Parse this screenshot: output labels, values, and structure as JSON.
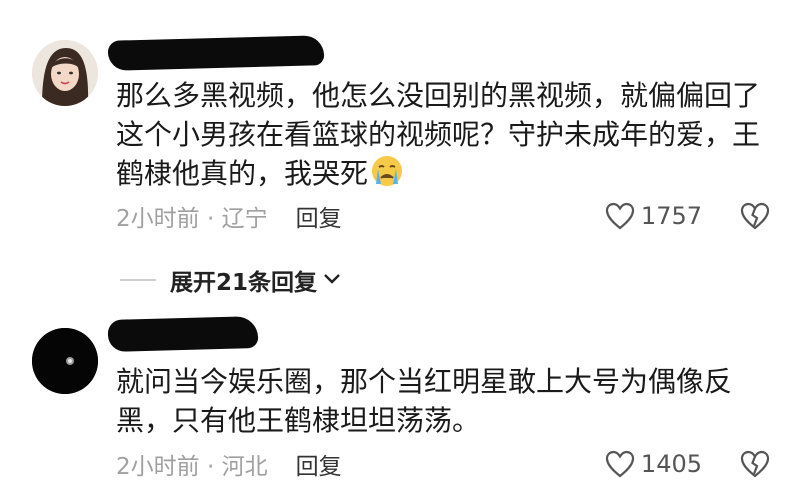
{
  "comments": [
    {
      "text": "那么多黑视频，他怎么没回别的黑视频，就偏偏回了这个小男孩在看篮球的视频呢？守护未成年的爱，王鹤棣他真的，我哭死",
      "time": "2小时前",
      "location": "辽宁",
      "reply_label": "回复",
      "likes": "1757",
      "emoji": "crying-face",
      "avatar": "photo-avatar"
    },
    {
      "text": "就问当今娱乐圈，那个当红明星敢上大号为偶像反黑，只有他王鹤棣坦坦荡荡。",
      "time": "2小时前",
      "location": "河北",
      "reply_label": "回复",
      "likes": "1405",
      "avatar": "black-avatar"
    }
  ],
  "expand_replies": {
    "label": "展开21条回复"
  },
  "colors": {
    "meta": "#a0a0a0",
    "text": "#1a1a1a",
    "divider": "#cfcfcf"
  }
}
